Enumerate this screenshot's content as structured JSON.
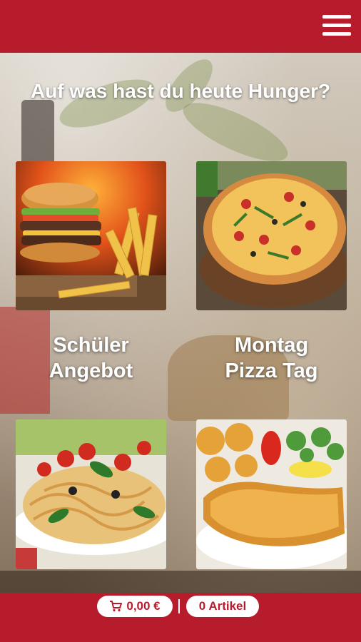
{
  "header": {
    "menu_icon": "hamburger-menu-icon",
    "color": "#b71c2d"
  },
  "headline": "Auf was hast du heute Hunger?",
  "tiles": [
    {
      "name": "burger",
      "image": "burger-and-fries-image"
    },
    {
      "name": "pizza",
      "image": "pizza-image"
    },
    {
      "name": "pasta",
      "image": "pasta-image"
    },
    {
      "name": "schnitzel",
      "image": "schnitzel-image"
    }
  ],
  "labels": {
    "schueler_line1": "Schüler",
    "schueler_line2": "Angebot",
    "montag_line1": "Montag",
    "montag_line2": "Pizza Tag"
  },
  "footer": {
    "cart_icon": "cart-icon",
    "cart_total": "0,00 €",
    "item_count": "0 Artikel"
  }
}
